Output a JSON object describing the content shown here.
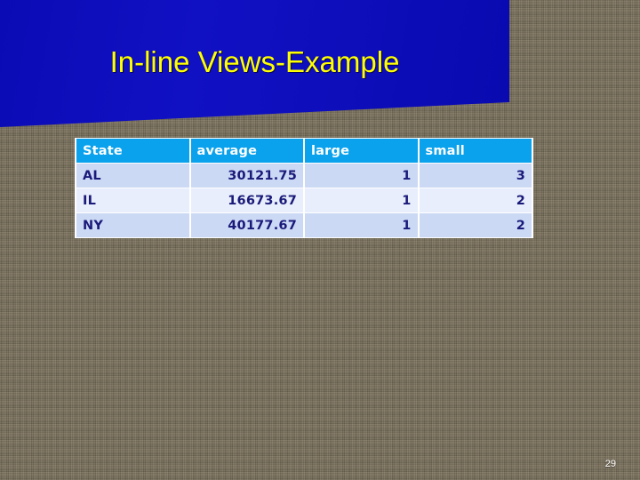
{
  "slide": {
    "title": "In-line Views-Example",
    "page_number": "29",
    "background_color": "#776d57",
    "banner_color": "#1111c4",
    "title_color": "#ffff00"
  },
  "table": {
    "header_bg": "#0aa2ec",
    "header_text_color": "#ffffff",
    "cell_text_color": "#1a1a7a",
    "row_odd_bg": "#ccd9f5",
    "row_even_bg": "#e8eefb",
    "columns": [
      {
        "label": "State",
        "align": "left"
      },
      {
        "label": "average",
        "align": "right"
      },
      {
        "label": "large",
        "align": "right"
      },
      {
        "label": "small",
        "align": "right"
      }
    ],
    "rows": [
      {
        "state": "AL",
        "average": "30121.75",
        "large": "1",
        "small": "3"
      },
      {
        "state": "IL",
        "average": "16673.67",
        "large": "1",
        "small": "2"
      },
      {
        "state": "NY",
        "average": "40177.67",
        "large": "1",
        "small": "2"
      }
    ]
  }
}
